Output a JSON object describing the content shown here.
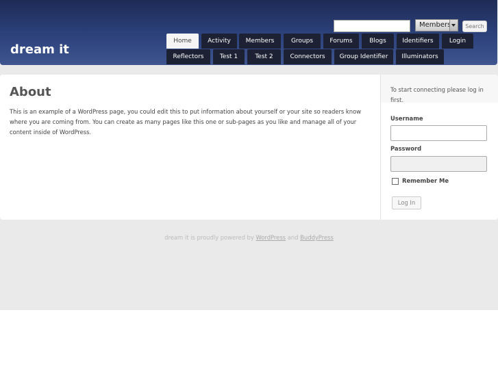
{
  "header": {
    "site_title": "dream it",
    "search": {
      "input_value": "",
      "scope_selected": "Members",
      "button_label": "Search"
    },
    "nav_row1": [
      {
        "label": "Home",
        "active": true
      },
      {
        "label": "Activity"
      },
      {
        "label": "Members"
      },
      {
        "label": "Groups"
      },
      {
        "label": "Forums"
      },
      {
        "label": "Blogs"
      },
      {
        "label": "Identifiers"
      },
      {
        "label": "Login"
      }
    ],
    "nav_row2": [
      {
        "label": "Reflectors"
      },
      {
        "label": "Test 1"
      },
      {
        "label": "Test 2"
      },
      {
        "label": "Connectors"
      },
      {
        "label": "Group Identifier"
      },
      {
        "label": "Illuminators"
      }
    ]
  },
  "main": {
    "title": "About",
    "body": "This is an example of a WordPress page, you could edit this to put information about yourself or your site so readers know where you are coming from. You can create as many pages like this one or sub-pages as you like and manage all of your content inside of WordPress."
  },
  "sidebar": {
    "login_intro": "To start connecting please log in first.",
    "username_label": "Username",
    "username_value": "",
    "password_label": "Password",
    "password_value": "",
    "remember_label": "Remember Me",
    "login_button": "Log In"
  },
  "footer": {
    "text_before": "dream it is proudly powered by ",
    "link1": "WordPress",
    "text_between": " and ",
    "link2": "BuddyPress"
  },
  "colors": {
    "header_dark": "#1d2b56",
    "header_light": "#3e5590",
    "nav_tab": "#1c2233",
    "page_bg": "#eaeaea"
  }
}
